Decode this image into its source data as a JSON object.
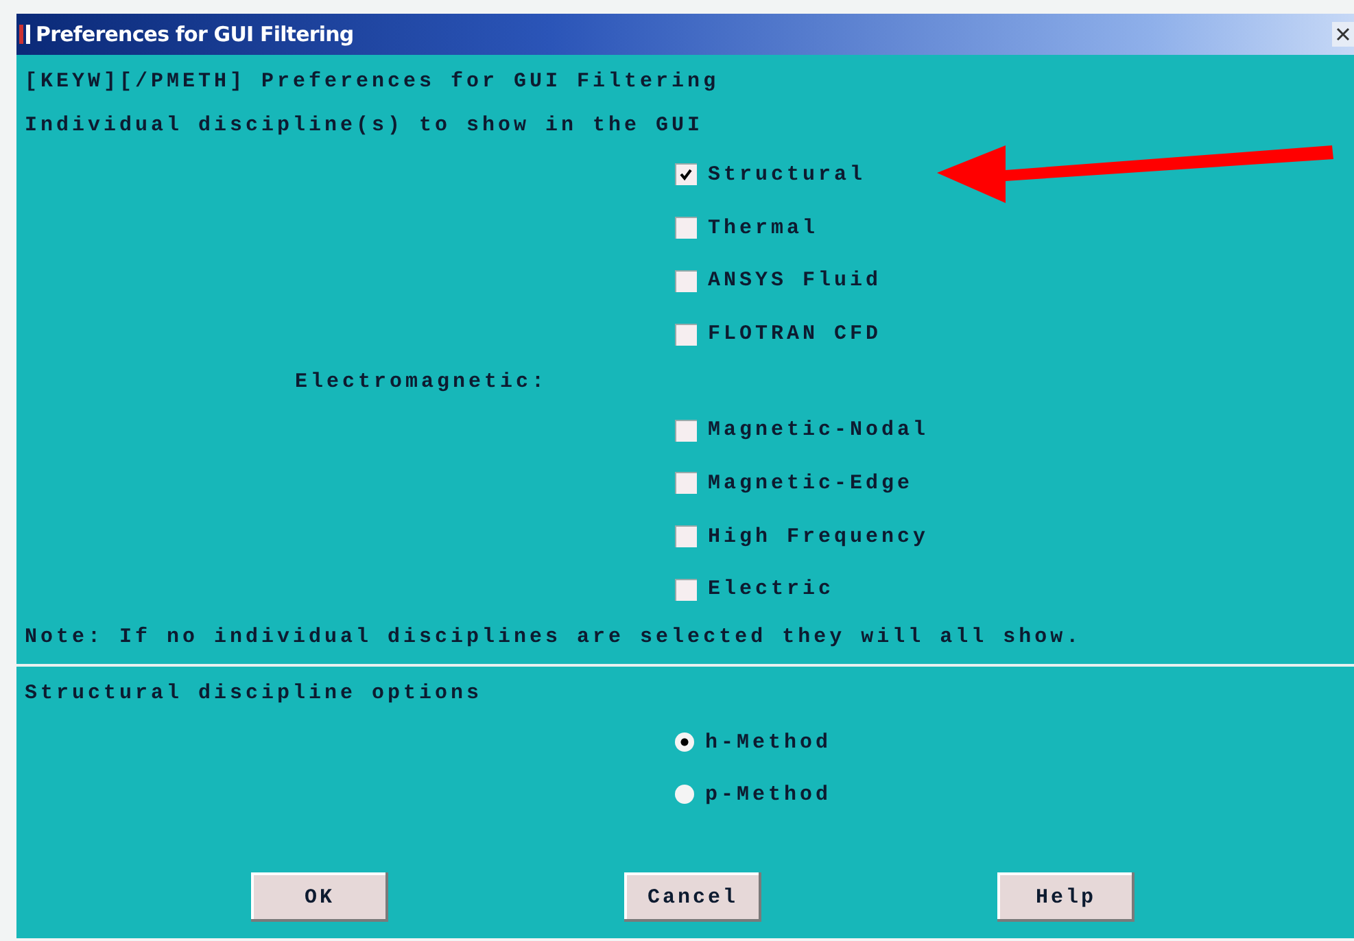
{
  "window": {
    "title": "Preferences for GUI Filtering"
  },
  "command_line": "[KEYW][/PMETH] Preferences for GUI Filtering",
  "disciplines": {
    "prompt": "Individual discipline(s) to show in the GUI",
    "items": [
      {
        "kind": "checkbox",
        "label": "Structural",
        "checked": true
      },
      {
        "kind": "checkbox",
        "label": "Thermal",
        "checked": false
      },
      {
        "kind": "checkbox",
        "label": "ANSYS Fluid",
        "checked": false
      },
      {
        "kind": "checkbox",
        "label": "FLOTRAN CFD",
        "checked": false
      },
      {
        "kind": "heading",
        "label": "Electromagnetic:"
      },
      {
        "kind": "checkbox",
        "label": "Magnetic-Nodal",
        "checked": false
      },
      {
        "kind": "checkbox",
        "label": "Magnetic-Edge",
        "checked": false
      },
      {
        "kind": "checkbox",
        "label": "High Frequency",
        "checked": false
      },
      {
        "kind": "checkbox",
        "label": "Electric",
        "checked": false
      }
    ],
    "note": "Note: If no individual disciplines are selected they will all show."
  },
  "structural_options": {
    "title": "Structural discipline options",
    "options": [
      {
        "label": "h-Method",
        "selected": true
      },
      {
        "label": "p-Method",
        "selected": false
      }
    ]
  },
  "buttons": [
    "OK",
    "Cancel",
    "Help"
  ]
}
